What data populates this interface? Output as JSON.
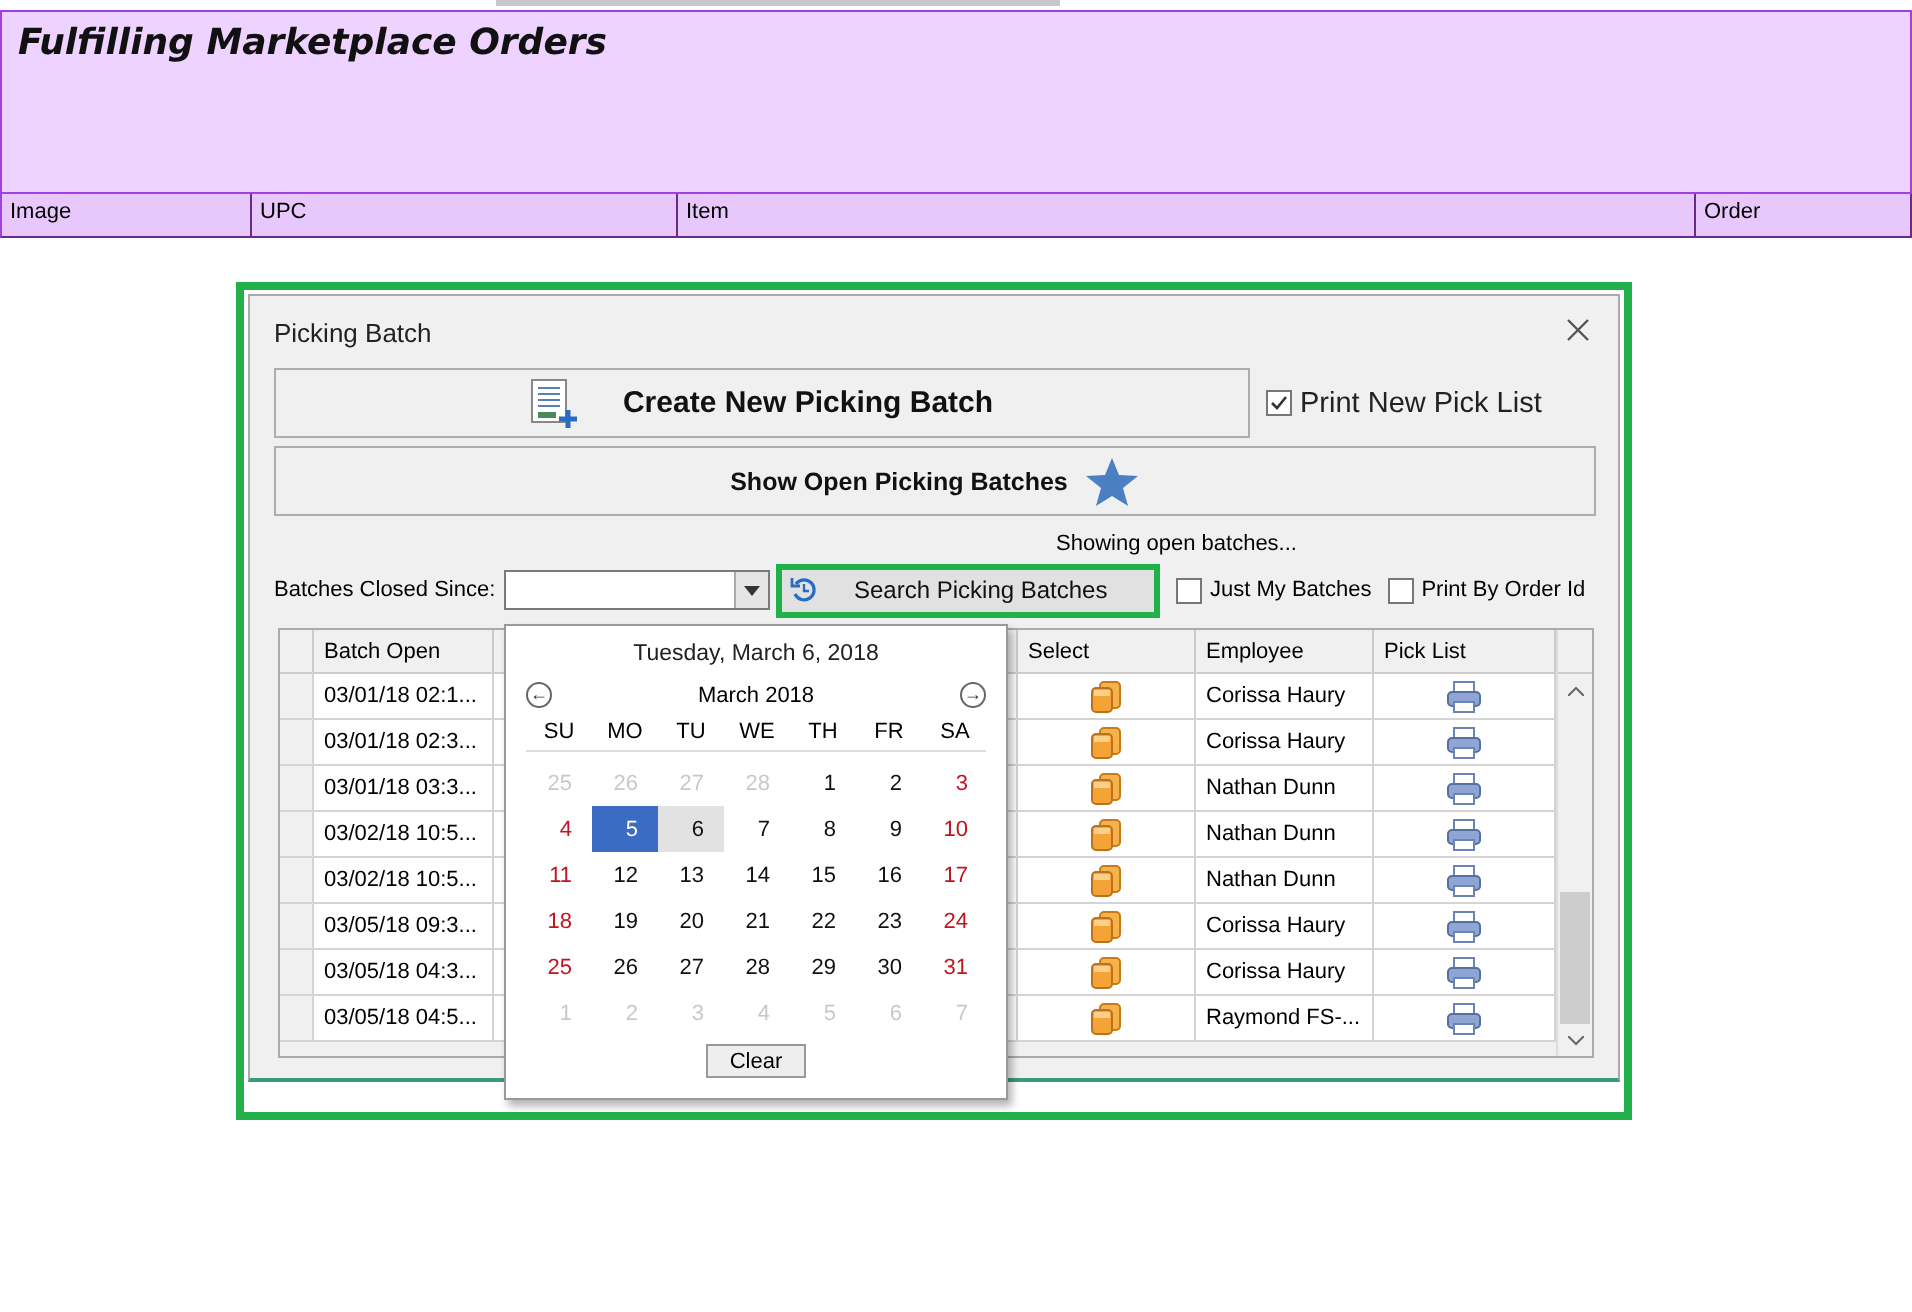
{
  "page": {
    "title": "Fulfilling Marketplace Orders",
    "columns": [
      "Image",
      "UPC",
      "Item",
      "Order"
    ]
  },
  "dialog": {
    "title": "Picking Batch",
    "create_button": "Create New Picking Batch",
    "print_new_pick_list": {
      "label": "Print New Pick List",
      "checked": true
    },
    "show_open_button": "Show Open Picking Batches",
    "status": "Showing open batches...",
    "closed_since": {
      "label": "Batches Closed Since:"
    },
    "search_button": "Search Picking Batches",
    "just_my_batches": {
      "label": "Just My Batches",
      "checked": false
    },
    "print_by_order_id": {
      "label": "Print By Order Id",
      "checked": false
    },
    "table": {
      "columns": [
        "Batch Open",
        "Select",
        "Employee",
        "Pick List"
      ],
      "rows": [
        {
          "batch_open": "03/01/18 02:1...",
          "employee": "Corissa Haury"
        },
        {
          "batch_open": "03/01/18 02:3...",
          "employee": "Corissa Haury"
        },
        {
          "batch_open": "03/01/18 03:3...",
          "employee": "Nathan Dunn"
        },
        {
          "batch_open": "03/02/18 10:5...",
          "employee": "Nathan Dunn"
        },
        {
          "batch_open": "03/02/18 10:5...",
          "employee": "Nathan Dunn"
        },
        {
          "batch_open": "03/05/18 09:3...",
          "employee": "Corissa Haury"
        },
        {
          "batch_open": "03/05/18 04:3...",
          "employee": "Corissa Haury"
        },
        {
          "batch_open": "03/05/18 04:5...",
          "employee": "Raymond FS-..."
        }
      ]
    },
    "calendar": {
      "today_text": "Tuesday, March 6, 2018",
      "month": "March 2018",
      "prev": "←",
      "next": "→",
      "weekdays": [
        "SU",
        "MO",
        "TU",
        "WE",
        "TH",
        "FR",
        "SA"
      ],
      "days": [
        {
          "d": "25",
          "kind": "other",
          "selected": false,
          "today": false
        },
        {
          "d": "26",
          "kind": "other",
          "selected": false,
          "today": false
        },
        {
          "d": "27",
          "kind": "other",
          "selected": false,
          "today": false
        },
        {
          "d": "28",
          "kind": "other",
          "selected": false,
          "today": false
        },
        {
          "d": "1",
          "kind": "day",
          "selected": false,
          "today": false
        },
        {
          "d": "2",
          "kind": "day",
          "selected": false,
          "today": false
        },
        {
          "d": "3",
          "kind": "weekend",
          "selected": false,
          "today": false
        },
        {
          "d": "4",
          "kind": "weekend",
          "selected": false,
          "today": false
        },
        {
          "d": "5",
          "kind": "day",
          "selected": true,
          "today": false
        },
        {
          "d": "6",
          "kind": "day",
          "selected": false,
          "today": true
        },
        {
          "d": "7",
          "kind": "day",
          "selected": false,
          "today": false
        },
        {
          "d": "8",
          "kind": "day",
          "selected": false,
          "today": false
        },
        {
          "d": "9",
          "kind": "day",
          "selected": false,
          "today": false
        },
        {
          "d": "10",
          "kind": "weekend",
          "selected": false,
          "today": false
        },
        {
          "d": "11",
          "kind": "weekend",
          "selected": false,
          "today": false
        },
        {
          "d": "12",
          "kind": "day",
          "selected": false,
          "today": false
        },
        {
          "d": "13",
          "kind": "day",
          "selected": false,
          "today": false
        },
        {
          "d": "14",
          "kind": "day",
          "selected": false,
          "today": false
        },
        {
          "d": "15",
          "kind": "day",
          "selected": false,
          "today": false
        },
        {
          "d": "16",
          "kind": "day",
          "selected": false,
          "today": false
        },
        {
          "d": "17",
          "kind": "weekend",
          "selected": false,
          "today": false
        },
        {
          "d": "18",
          "kind": "weekend",
          "selected": false,
          "today": false
        },
        {
          "d": "19",
          "kind": "day",
          "selected": false,
          "today": false
        },
        {
          "d": "20",
          "kind": "day",
          "selected": false,
          "today": false
        },
        {
          "d": "21",
          "kind": "day",
          "selected": false,
          "today": false
        },
        {
          "d": "22",
          "kind": "day",
          "selected": false,
          "today": false
        },
        {
          "d": "23",
          "kind": "day",
          "selected": false,
          "today": false
        },
        {
          "d": "24",
          "kind": "weekend",
          "selected": false,
          "today": false
        },
        {
          "d": "25",
          "kind": "weekend",
          "selected": false,
          "today": false
        },
        {
          "d": "26",
          "kind": "day",
          "selected": false,
          "today": false
        },
        {
          "d": "27",
          "kind": "day",
          "selected": false,
          "today": false
        },
        {
          "d": "28",
          "kind": "day",
          "selected": false,
          "today": false
        },
        {
          "d": "29",
          "kind": "day",
          "selected": false,
          "today": false
        },
        {
          "d": "30",
          "kind": "day",
          "selected": false,
          "today": false
        },
        {
          "d": "31",
          "kind": "weekend",
          "selected": false,
          "today": false
        },
        {
          "d": "1",
          "kind": "other",
          "selected": false,
          "today": false
        },
        {
          "d": "2",
          "kind": "other",
          "selected": false,
          "today": false
        },
        {
          "d": "3",
          "kind": "other",
          "selected": false,
          "today": false
        },
        {
          "d": "4",
          "kind": "other",
          "selected": false,
          "today": false
        },
        {
          "d": "5",
          "kind": "other",
          "selected": false,
          "today": false
        },
        {
          "d": "6",
          "kind": "other",
          "selected": false,
          "today": false
        },
        {
          "d": "7",
          "kind": "other",
          "selected": false,
          "today": false
        }
      ],
      "clear_button": "Clear"
    }
  }
}
